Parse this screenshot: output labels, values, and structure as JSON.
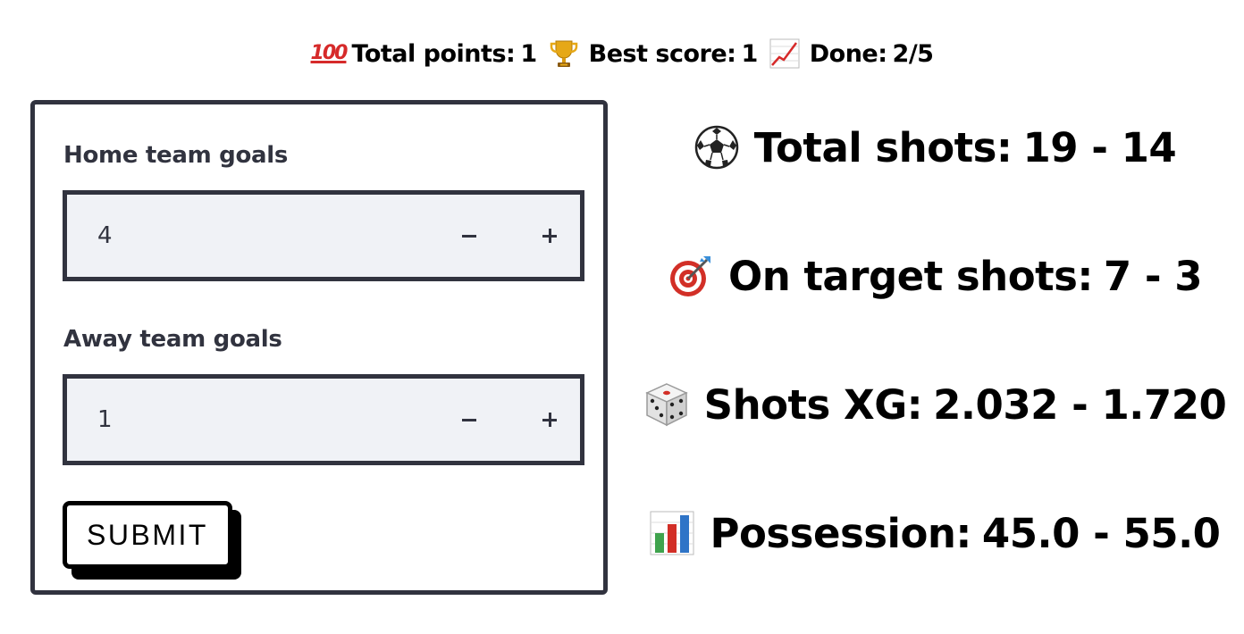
{
  "status": {
    "items": [
      {
        "icon": "hundred-points-icon",
        "glyph": "100",
        "label": "Total points:",
        "value": "1"
      },
      {
        "icon": "trophy-icon",
        "label": "Best score:",
        "value": "1"
      },
      {
        "icon": "chart-increasing-icon",
        "label": "Done:",
        "value": "2/5"
      }
    ]
  },
  "form": {
    "home": {
      "label": "Home team goals",
      "value": "4"
    },
    "away": {
      "label": "Away team goals",
      "value": "1"
    },
    "submit_label": "SUBMIT"
  },
  "stats": {
    "total_shots": {
      "icon": "soccer-ball-icon",
      "label": "Total shots:",
      "value": "19 - 14"
    },
    "on_target": {
      "icon": "direct-hit-icon",
      "label": "On target shots:",
      "value": "7 - 3"
    },
    "xg": {
      "icon": "game-die-icon",
      "label": "Shots XG:",
      "value": "2.032 - 1.720"
    },
    "possession": {
      "icon": "bar-chart-icon",
      "label": "Possession:",
      "value": "45.0 - 55.0"
    }
  },
  "colors": {
    "text_dark": "#31333f",
    "input_bg": "#f0f2f6",
    "hundred_red": "#d62a2a"
  }
}
